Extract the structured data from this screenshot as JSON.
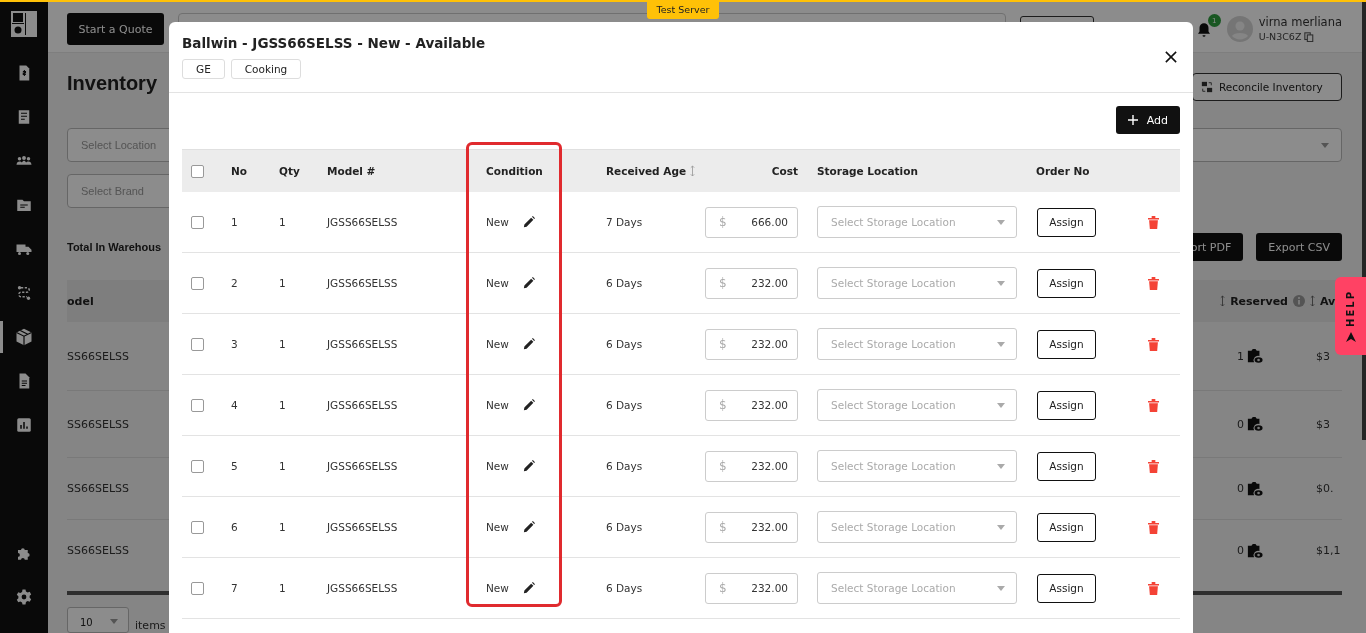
{
  "top_banner": {
    "label": "Test Server"
  },
  "sidebar": {
    "items": [
      {
        "selected": false
      },
      {
        "selected": false
      },
      {
        "selected": false
      },
      {
        "selected": false
      },
      {
        "selected": false
      },
      {
        "selected": false
      },
      {
        "selected": true
      },
      {
        "selected": false
      },
      {
        "selected": false
      }
    ],
    "bottom_items": [
      {
        "selected": false
      },
      {
        "selected": false
      }
    ]
  },
  "header": {
    "start_quote_button": "Start a Quote",
    "notification_count": "1",
    "user": {
      "name": "virna merliana",
      "id": "U-N3C6Z"
    }
  },
  "page": {
    "title": "Inventory",
    "reconcile_button": "Reconcile Inventory",
    "location_filter": {
      "placeholder": "Select Location"
    },
    "brand_filter": {
      "placeholder": "Select Brand"
    },
    "total_label": "Total In Warehous",
    "export_pdf_button": "ort PDF",
    "export_csv_button": "Export CSV",
    "table": {
      "columns": [
        "odel",
        "Reserved",
        "Av"
      ],
      "rows": [
        {
          "model": "SS66SELSS",
          "reserved": "1",
          "amount": "$3"
        },
        {
          "model": "SS66SELSS",
          "reserved": "0",
          "amount": "$3"
        },
        {
          "model": "SS66SELSS",
          "reserved": "0",
          "amount": "$0."
        },
        {
          "model": "SS66SELSS",
          "reserved": "0",
          "amount": "$1,1"
        }
      ]
    },
    "pagination": {
      "page_size": "10",
      "label": "items"
    }
  },
  "help_tab": {
    "label": "HELP"
  },
  "modal": {
    "title": "Ballwin - JGSS66SELSS - New - Available",
    "tags": [
      "GE",
      "Cooking"
    ],
    "add_button": "Add",
    "table": {
      "select_all": {
        "checked": false
      },
      "columns": [
        {
          "label": "No"
        },
        {
          "label": "Qty"
        },
        {
          "label": "Model #"
        },
        {
          "label": "Condition"
        },
        {
          "label": "Received Age",
          "sortable": true
        },
        {
          "label": "Cost"
        },
        {
          "label": "Storage Location"
        },
        {
          "label": "Order No"
        }
      ],
      "rows": [
        {
          "checked": false,
          "no": "1",
          "qty": "1",
          "model": "JGSS66SELSS",
          "condition": "New",
          "age": "7 Days",
          "currency": "$",
          "cost": "666.00",
          "storage_placeholder": "Select Storage Location",
          "order_button": "Assign"
        },
        {
          "checked": false,
          "no": "2",
          "qty": "1",
          "model": "JGSS66SELSS",
          "condition": "New",
          "age": "6 Days",
          "currency": "$",
          "cost": "232.00",
          "storage_placeholder": "Select Storage Location",
          "order_button": "Assign"
        },
        {
          "checked": false,
          "no": "3",
          "qty": "1",
          "model": "JGSS66SELSS",
          "condition": "New",
          "age": "6 Days",
          "currency": "$",
          "cost": "232.00",
          "storage_placeholder": "Select Storage Location",
          "order_button": "Assign"
        },
        {
          "checked": false,
          "no": "4",
          "qty": "1",
          "model": "JGSS66SELSS",
          "condition": "New",
          "age": "6 Days",
          "currency": "$",
          "cost": "232.00",
          "storage_placeholder": "Select Storage Location",
          "order_button": "Assign"
        },
        {
          "checked": false,
          "no": "5",
          "qty": "1",
          "model": "JGSS66SELSS",
          "condition": "New",
          "age": "6 Days",
          "currency": "$",
          "cost": "232.00",
          "storage_placeholder": "Select Storage Location",
          "order_button": "Assign"
        },
        {
          "checked": false,
          "no": "6",
          "qty": "1",
          "model": "JGSS66SELSS",
          "condition": "New",
          "age": "6 Days",
          "currency": "$",
          "cost": "232.00",
          "storage_placeholder": "Select Storage Location",
          "order_button": "Assign"
        },
        {
          "checked": false,
          "no": "7",
          "qty": "1",
          "model": "JGSS66SELSS",
          "condition": "New",
          "age": "6 Days",
          "currency": "$",
          "cost": "232.00",
          "storage_placeholder": "Select Storage Location",
          "order_button": "Assign"
        }
      ]
    }
  }
}
